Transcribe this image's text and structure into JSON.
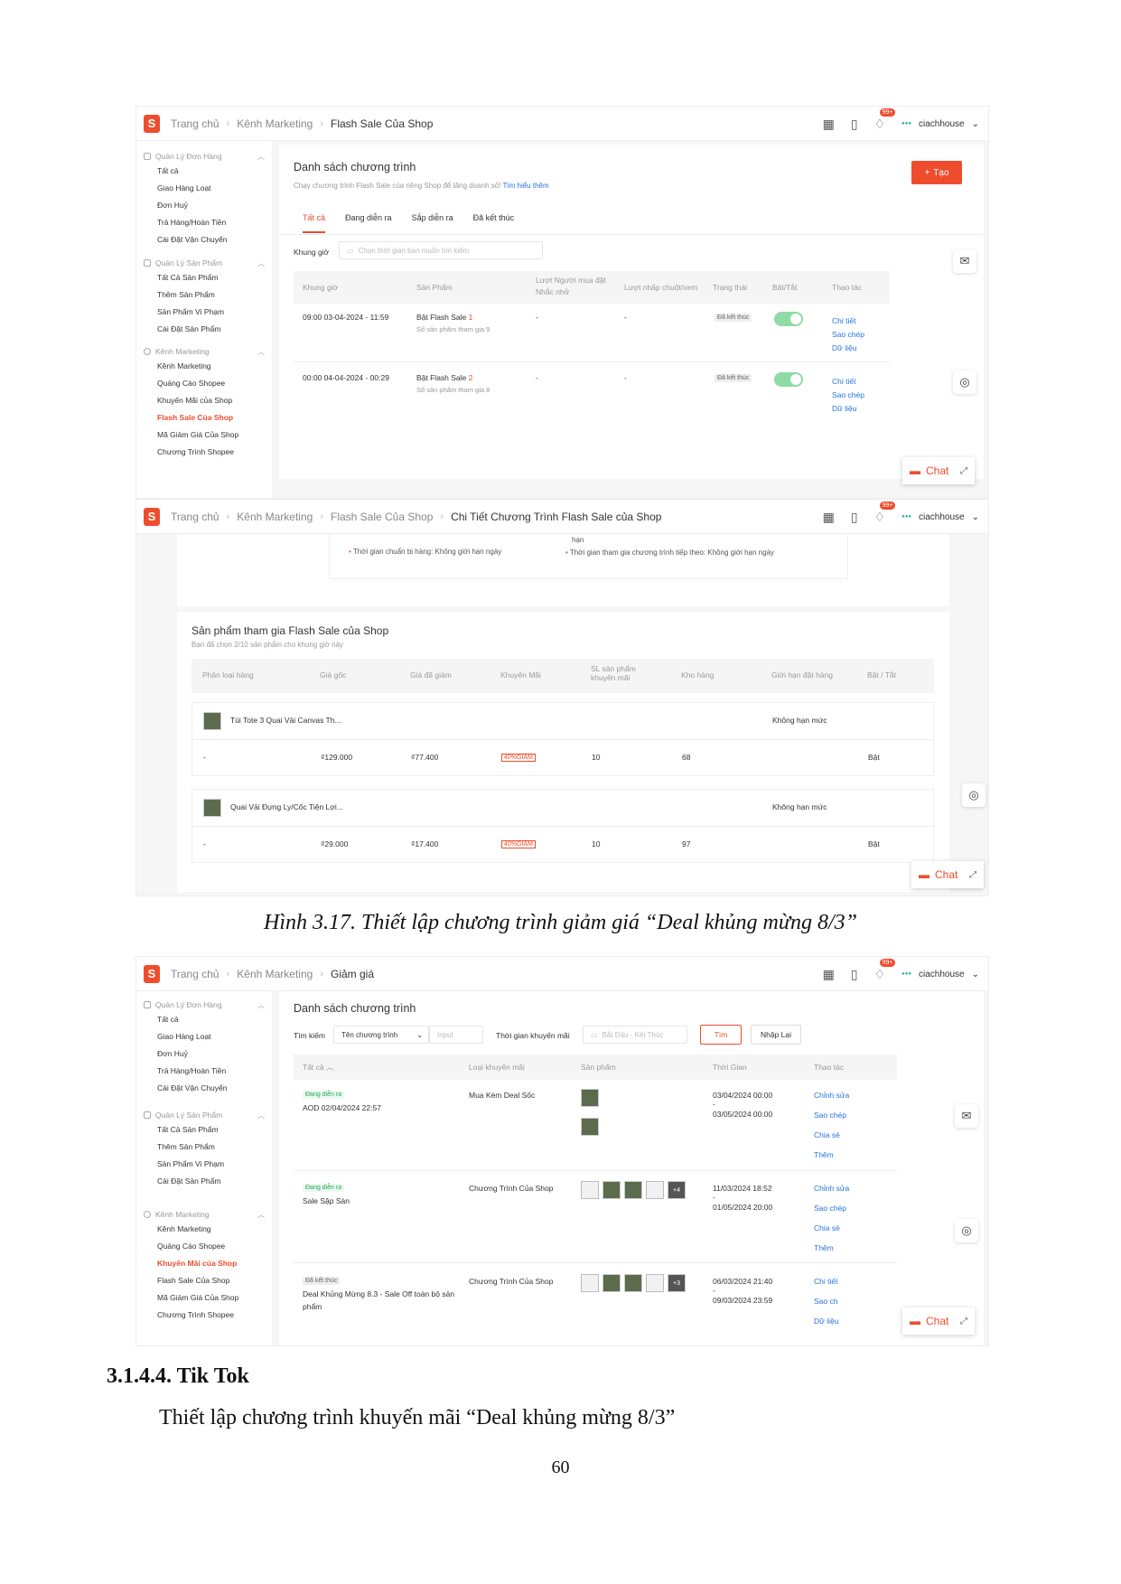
{
  "shop": "ciachhouse",
  "notif_badge": "99+",
  "chat_label": "Chat",
  "sidebar": {
    "orders": {
      "title": "Quản Lý Đơn Hàng",
      "items": [
        "Tất cả",
        "Giao Hàng Loạt",
        "Đơn Huỷ",
        "Trả Hàng/Hoàn Tiền",
        "Cài Đặt Vận Chuyển"
      ]
    },
    "products": {
      "title": "Quản Lý Sản Phẩm",
      "items": [
        "Tất Cả Sản Phẩm",
        "Thêm Sản Phẩm",
        "Sản Phẩm Vi Phạm",
        "Cài Đặt Sản Phẩm"
      ]
    },
    "marketing": {
      "title": "Kênh Marketing",
      "items": [
        "Kênh Marketing",
        "Quảng Cáo Shopee",
        "Khuyến Mãi của Shop",
        "Flash Sale Của Shop",
        "Mã Giảm Giá Của Shop",
        "Chương Trình Shopee"
      ]
    }
  },
  "shot1": {
    "breadcrumb": [
      "Trang chủ",
      "Kênh Marketing",
      "Flash Sale Của Shop"
    ],
    "title": "Danh sách chương trình",
    "subtitle": "Chạy chương trình Flash Sale của riêng Shop để tăng doanh số!",
    "learn_more": "Tìm hiểu thêm",
    "create_button": "Tạo",
    "tabs": [
      "Tất cả",
      "Đang diễn ra",
      "Sắp diễn ra",
      "Đã kết thúc"
    ],
    "slot_label": "Khung giờ",
    "slot_placeholder": "Chọn thời gian bạn muốn tìm kiếm",
    "columns": [
      "Khung giờ",
      "Sản Phẩm",
      "Lượt Người mua đặt Nhắc nhở",
      "Lượt nhấp chuột/xem",
      "Trạng thái",
      "Bật/Tắt",
      "Thao tác"
    ],
    "rows": [
      {
        "slot": "09:00 03-04-2024 - 11:59",
        "product_prefix": "Bật Flash Sale",
        "product_num": "1",
        "product_count": "Số sản phẩm tham gia 9",
        "reminders": "-",
        "clicks": "-",
        "status": "Đã kết thúc",
        "actions": [
          "Chi tiết",
          "Sao chép",
          "Dữ liệu"
        ]
      },
      {
        "slot": "00:00 04-04-2024 - 00:29",
        "product_prefix": "Bật Flash Sale",
        "product_num": "2",
        "product_count": "Số sản phẩm tham gia 8",
        "reminders": "-",
        "clicks": "-",
        "status": "Đã kết thúc",
        "actions": [
          "Chi tiết",
          "Sao chép",
          "Dữ liệu"
        ]
      }
    ]
  },
  "shot2": {
    "breadcrumb": [
      "Trang chủ",
      "Kênh Marketing",
      "Flash Sale Của Shop",
      "Chi Tiết Chương Trình Flash Sale của Shop"
    ],
    "criteria_left": "Thời gian chuẩn bị hàng: Không giới hạn ngày",
    "criteria_right_top": "hạn",
    "criteria_right": "Thời gian tham gia chương trình tiếp theo: Không giới hạn ngày",
    "title": "Sản phẩm tham gia Flash Sale của Shop",
    "subtitle": "Bạn đã chọn 2/10 sản phẩm cho khung giờ này",
    "columns": [
      "Phân loại hàng",
      "Giá gốc",
      "Giá đã giảm",
      "Khuyến Mãi",
      "SL sản phẩm khuyến mãi",
      "Kho hàng",
      "Giới hạn đặt hàng",
      "Bật / Tắt"
    ],
    "products": [
      {
        "name": "Túi Tote 3 Quai Vải Canvas Th...",
        "limit": "Không hạn mức",
        "variant": "-",
        "orig": "₫129.000",
        "sale": "₫77.400",
        "promo": "40%GIẢM",
        "qty": "10",
        "stock": "68",
        "state": "Bật"
      },
      {
        "name": "Quai Vải Đựng Ly/Cốc Tiện Lợi...",
        "limit": "Không hạn mức",
        "variant": "-",
        "orig": "₫29.000",
        "sale": "₫17.400",
        "promo": "40%GIẢM",
        "qty": "10",
        "stock": "97",
        "state": "Bật"
      }
    ]
  },
  "caption": "Hình 3.17. Thiết lập chương trình giảm giá “Deal khủng mừng 8/3”",
  "shot3": {
    "breadcrumb": [
      "Trang chủ",
      "Kênh Marketing",
      "Giảm giá"
    ],
    "title": "Danh sách chương trình",
    "search_label": "Tìm kiếm",
    "search_select": "Tên chương trình",
    "search_placeholder": "Input",
    "time_label": "Thời gian khuyến mãi",
    "time_placeholder": "Bắt Đầu - Kết Thúc",
    "find_button": "Tìm",
    "reset_button": "Nhập Lại",
    "columns": [
      "Tất cả",
      "Loại khuyến mãi",
      "Sản phẩm",
      "Thời Gian",
      "Thao tác"
    ],
    "rows": [
      {
        "status": "Đang diễn ra",
        "name": "AOD 02/04/2024 22:57",
        "name2": "",
        "type": "Mua Kèm Deal Sốc",
        "start": "03/04/2024 00:00",
        "dash": "-",
        "end": "03/05/2024 00:00",
        "actions": [
          "Chỉnh sửa",
          "Sao chép",
          "Chia sẻ",
          "Thêm"
        ],
        "more": ""
      },
      {
        "status": "Đang diễn ra",
        "name": "Sale Sập Sàn",
        "name2": "",
        "type": "Chương Trình Của Shop",
        "start": "11/03/2024 18:52",
        "dash": "-",
        "end": "01/05/2024 20:00",
        "actions": [
          "Chỉnh sửa",
          "Sao chép",
          "Chia sẻ",
          "Thêm"
        ],
        "more": "+4"
      },
      {
        "status": "Đã kết thúc",
        "name": "Deal Khủng Mừng 8.3 - Sale Off toàn bộ sản",
        "name2": "phẩm",
        "type": "Chương Trình Của Shop",
        "start": "06/03/2024 21:40",
        "dash": "-",
        "end": "09/03/2024 23:59",
        "actions": [
          "Chi tiết",
          "Sao ch",
          "Dữ liệu"
        ],
        "more": "+3"
      }
    ]
  },
  "heading": "3.1.4.4. Tik Tok",
  "paragraph": "Thiết lập chương trình khuyến mãi “Deal khủng mừng 8/3”",
  "page_number": "60"
}
